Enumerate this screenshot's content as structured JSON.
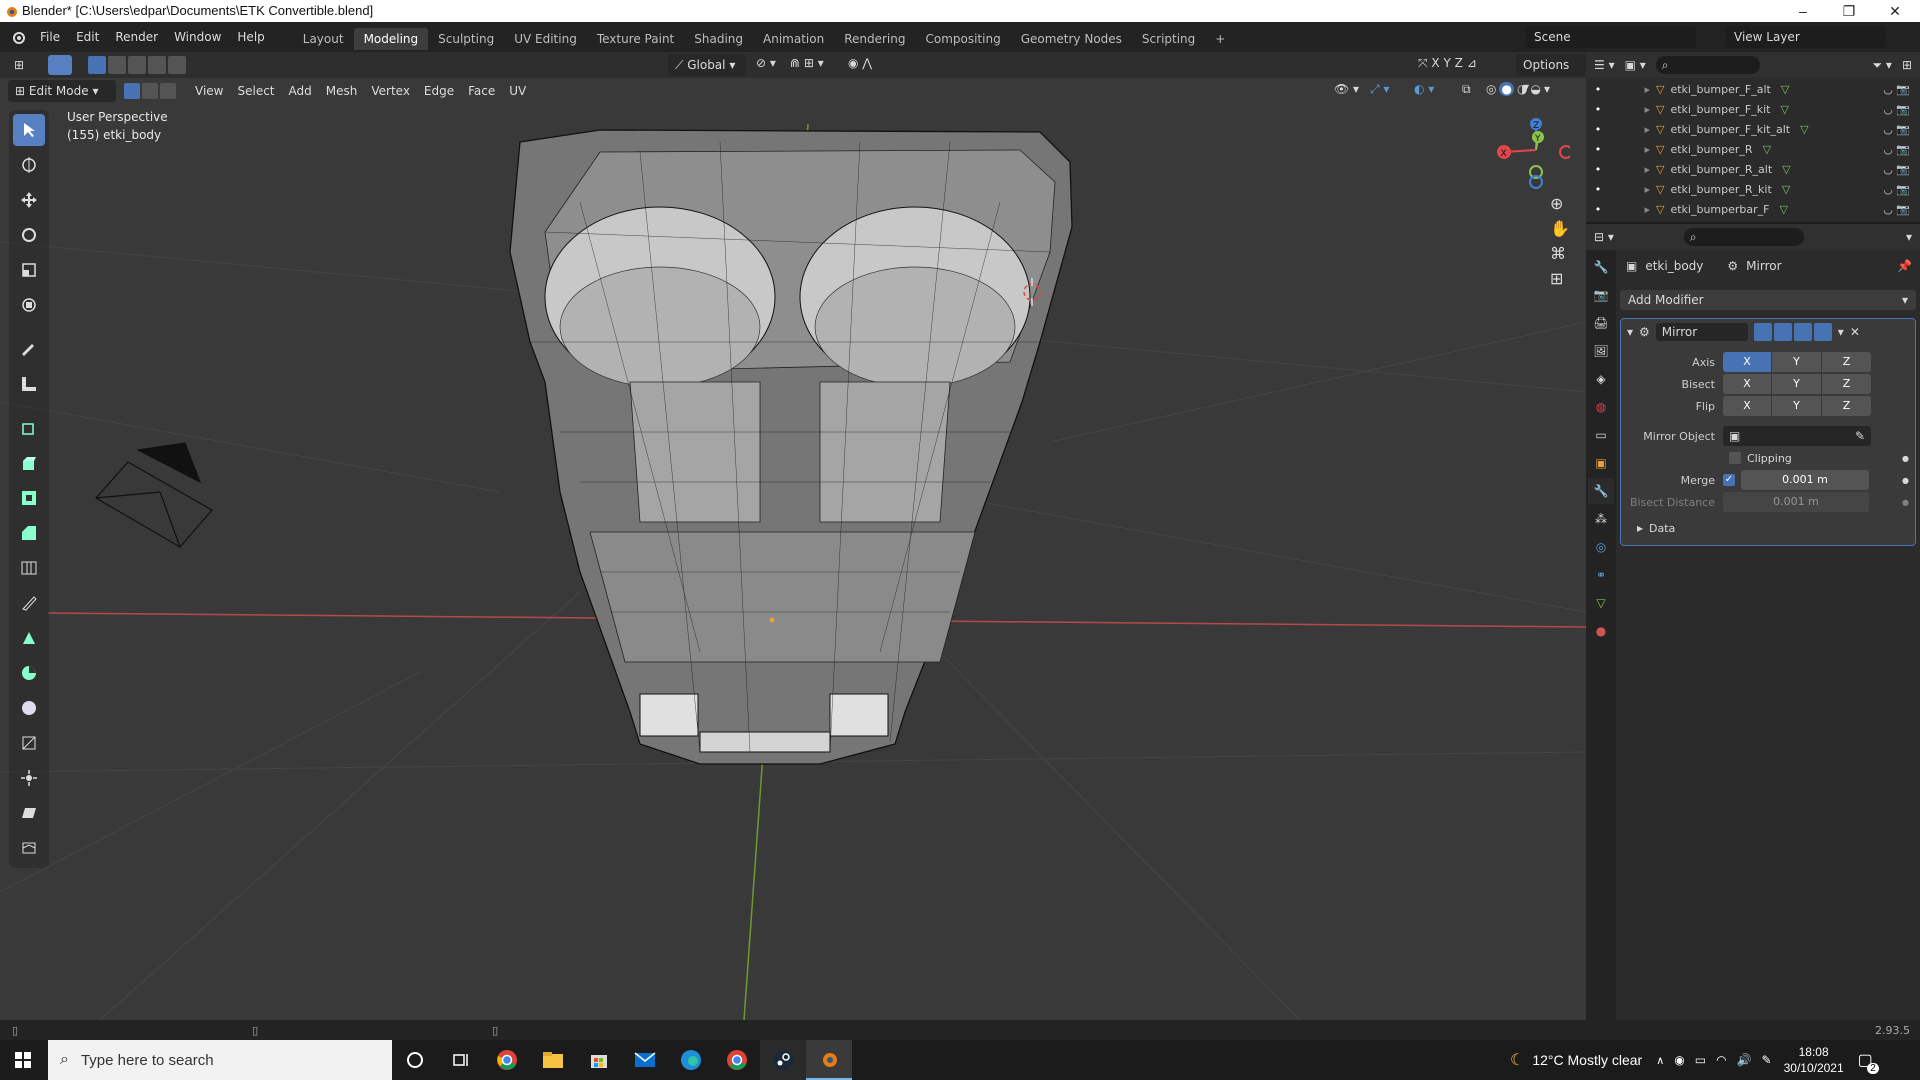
{
  "window": {
    "title": "Blender* [C:\\Users\\edpar\\Documents\\ETK Convertible.blend]"
  },
  "menu": [
    "File",
    "Edit",
    "Render",
    "Window",
    "Help"
  ],
  "workspaces": [
    "Layout",
    "Modeling",
    "Sculpting",
    "UV Editing",
    "Texture Paint",
    "Shading",
    "Animation",
    "Rendering",
    "Compositing",
    "Geometry Nodes",
    "Scripting"
  ],
  "active_workspace": "Modeling",
  "scene": {
    "name": "Scene",
    "view_layer": "View Layer"
  },
  "viewport": {
    "mode": "Edit Mode",
    "header_menus": [
      "View",
      "Select",
      "Add",
      "Mesh",
      "Vertex",
      "Edge",
      "Face",
      "UV"
    ],
    "transform": "Global",
    "options_label": "Options",
    "axis_lock": [
      "X",
      "Y",
      "Z"
    ],
    "overlay_text": {
      "line1": "User Perspective",
      "line2": "(155) etki_body"
    },
    "gizmo": {
      "x": "X",
      "y": "Y",
      "z": "Z"
    }
  },
  "outliner": {
    "items": [
      "etki_bumper_F_alt",
      "etki_bumper_F_kit",
      "etki_bumper_F_kit_alt",
      "etki_bumper_R",
      "etki_bumper_R_alt",
      "etki_bumper_R_kit",
      "etki_bumperbar_F"
    ]
  },
  "properties": {
    "object_name": "etki_body",
    "modifier_breadcrumb": "Mirror",
    "add_modifier": "Add Modifier",
    "modifier": {
      "name": "Mirror",
      "axis_label": "Axis",
      "bisect_label": "Bisect",
      "flip_label": "Flip",
      "axes": [
        "X",
        "Y",
        "Z"
      ],
      "mirror_object_label": "Mirror Object",
      "clipping_label": "Clipping",
      "merge_label": "Merge",
      "merge_value": "0.001 m",
      "bisect_distance_label": "Bisect Distance",
      "bisect_distance_value": "0.001 m",
      "data_label": "Data"
    }
  },
  "status": {
    "version": "2.93.5"
  },
  "taskbar": {
    "search_placeholder": "Type here to search",
    "weather": "12°C  Mostly clear",
    "time": "18:08",
    "date": "30/10/2021",
    "notif_count": "2"
  },
  "colors": {
    "accent": "#4772b3",
    "x_axis": "#e0474a",
    "y_axis": "#8bc34a",
    "z_axis": "#3f7fd4"
  }
}
